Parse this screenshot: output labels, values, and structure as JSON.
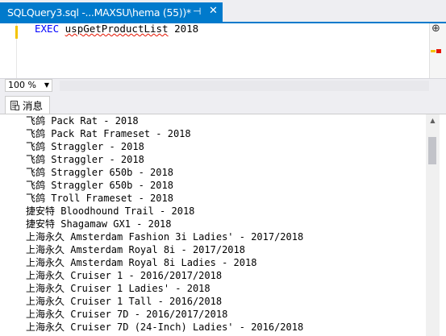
{
  "tab": {
    "title": "SQLQuery3.sql -...MAXSU\\hema (55))*",
    "pin_glyph": "⊣",
    "close_glyph": "✕"
  },
  "editor": {
    "keyword": "EXEC",
    "procedure": "uspGetProductList",
    "argument": "2018",
    "split_glyph": "⊕"
  },
  "zoom": {
    "value": "100 %"
  },
  "results": {
    "messages_tab_label": "消息"
  },
  "messages": [
    "飞鸽 Pack Rat - 2018",
    "飞鸽 Pack Rat Frameset - 2018",
    "飞鸽 Straggler - 2018",
    "飞鸽 Straggler - 2018",
    "飞鸽 Straggler 650b - 2018",
    "飞鸽 Straggler 650b - 2018",
    "飞鸽 Troll Frameset - 2018",
    "捷安特 Bloodhound Trail - 2018",
    "捷安特 Shagamaw GX1 - 2018",
    "上海永久 Amsterdam Fashion 3i Ladies' - 2017/2018",
    "上海永久 Amsterdam Royal 8i - 2017/2018",
    "上海永久 Amsterdam Royal 8i Ladies - 2018",
    "上海永久 Cruiser 1 - 2016/2017/2018",
    "上海永久 Cruiser 1 Ladies' - 2018",
    "上海永久 Cruiser 1 Tall - 2016/2018",
    "上海永久 Cruiser 7D - 2016/2017/2018",
    "上海永久 Cruiser 7D (24-Inch) Ladies' - 2016/2018"
  ]
}
